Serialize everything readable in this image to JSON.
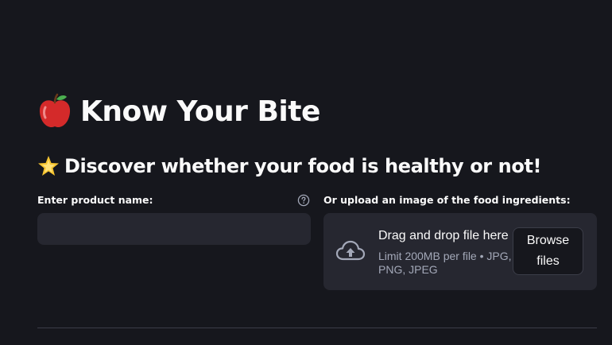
{
  "header": {
    "title": "Know Your Bite",
    "title_icon": "red-apple-icon",
    "subtitle": "Discover whether your food is healthy or not!",
    "subtitle_icon": "glowing-star-icon"
  },
  "product_input": {
    "label": "Enter product name:",
    "value": "",
    "help_icon": "question-circle-icon"
  },
  "uploader": {
    "label": "Or upload an image of the food ingredients:",
    "drop_title": "Drag and drop file here",
    "limit_text": "Limit 200MB per file • JPG, PNG, JPEG",
    "browse_label": "Browse files",
    "icon": "cloud-upload-icon"
  },
  "colors": {
    "background": "#16171d",
    "input_background": "#262730",
    "text": "#fafafa",
    "muted_text": "#a3a8b8",
    "divider": "#3b3d48"
  }
}
